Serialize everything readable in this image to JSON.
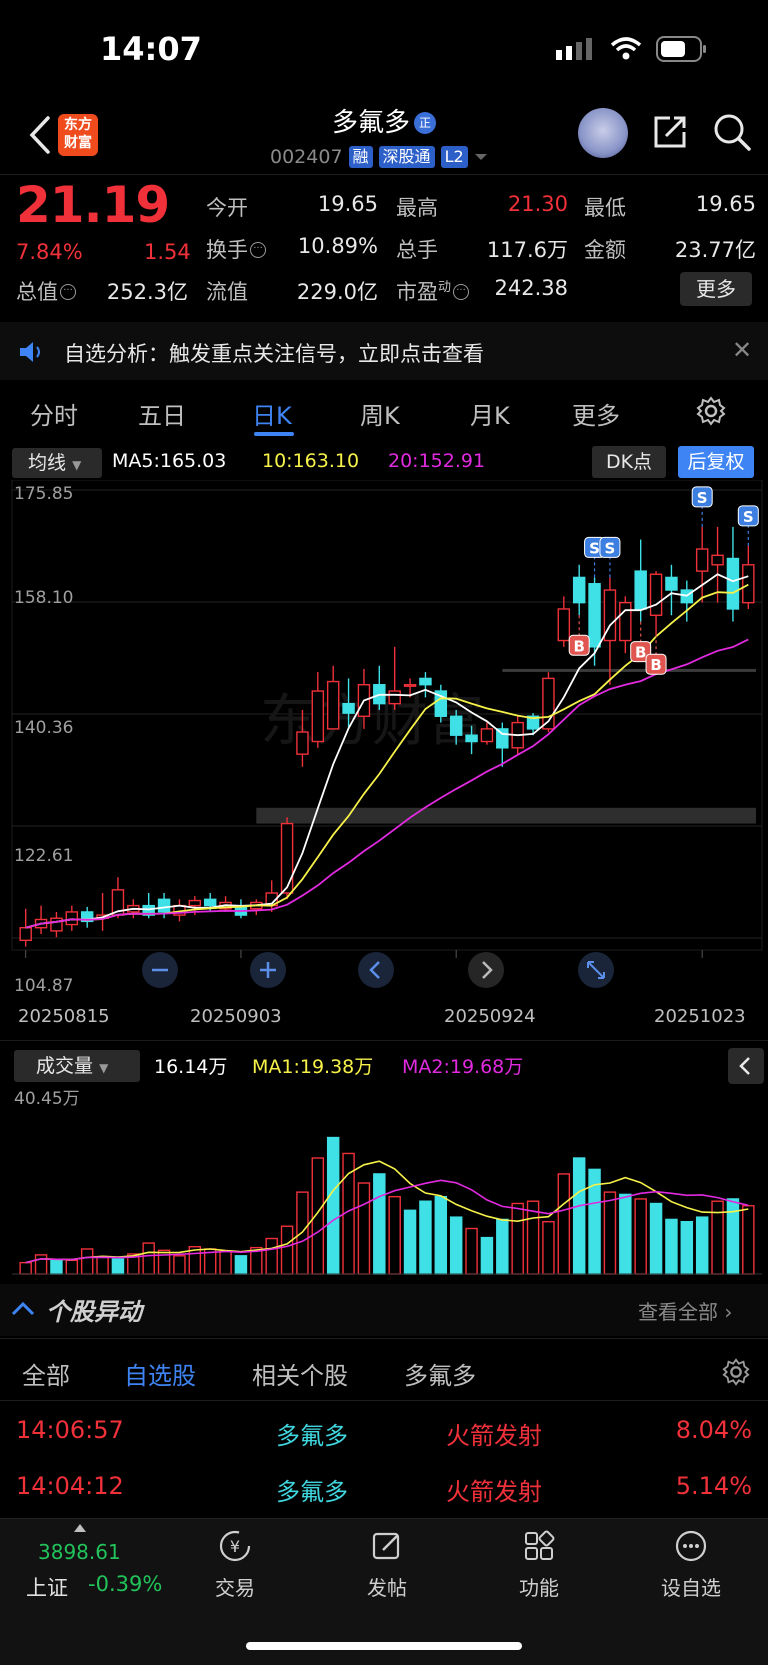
{
  "status": {
    "time": "14:07"
  },
  "header": {
    "logo_line1": "东方",
    "logo_line2": "财富",
    "stock_name": "多氟多",
    "name_tag": "正",
    "code": "002407",
    "badges": [
      "融",
      "深股通",
      "L2"
    ]
  },
  "quote": {
    "price": "21.19",
    "pct": "7.84%",
    "chg": "1.54",
    "fields": {
      "open_label": "今开",
      "open": "19.65",
      "high_label": "最高",
      "high": "21.30",
      "low_label": "最低",
      "low": "19.65",
      "turnover_label": "换手",
      "turnover": "10.89%",
      "vol_label": "总手",
      "vol": "117.6万",
      "amount_label": "金额",
      "amount": "23.77亿",
      "mcap_label": "总值",
      "mcap": "252.3亿",
      "float_label": "流值",
      "float": "229.0亿",
      "pe_label": "市盈",
      "pe_sup": "动",
      "pe": "242.38"
    },
    "more_label": "更多"
  },
  "banner": {
    "text": "自选分析：触发重点关注信号，立即点击查看"
  },
  "tabs": [
    "分时",
    "五日",
    "日K",
    "周K",
    "月K",
    "更多"
  ],
  "active_tab": "日K",
  "indicator": {
    "select_label": "均线",
    "ma5": "MA5:165.03",
    "ma10": "10:163.10",
    "ma20": "20:152.91",
    "dk_label": "DK点",
    "fq_label": "后复权"
  },
  "chart_data": {
    "type": "candlestick",
    "y_ticks": [
      "175.85",
      "158.10",
      "140.36",
      "122.61",
      "104.87"
    ],
    "ylim": [
      104.87,
      175.85
    ],
    "x_ticks": [
      "20250815",
      "20250903",
      "20250924",
      "20251023"
    ],
    "candles": [
      [
        104.5,
        106.5,
        103.5,
        109.5
      ],
      [
        106.5,
        107.8,
        105.5,
        110.0
      ],
      [
        106.0,
        108.0,
        105.0,
        109.0
      ],
      [
        107.0,
        109.0,
        106.0,
        110.0
      ],
      [
        109.0,
        107.5,
        106.5,
        109.8
      ],
      [
        108.0,
        108.5,
        106.0,
        112.0
      ],
      [
        108.5,
        112.5,
        108.0,
        114.5
      ],
      [
        109.0,
        110.0,
        108.0,
        111.0
      ],
      [
        110.0,
        108.5,
        108.0,
        112.0
      ],
      [
        111.0,
        109.0,
        108.0,
        112.0
      ],
      [
        108.5,
        110.0,
        107.5,
        111.0
      ],
      [
        110.0,
        110.8,
        108.5,
        111.5
      ],
      [
        111.0,
        110.0,
        109.0,
        112.0
      ],
      [
        109.5,
        110.5,
        109.0,
        111.5
      ],
      [
        110.0,
        108.5,
        108.0,
        111.0
      ],
      [
        109.5,
        110.5,
        108.5,
        111.0
      ],
      [
        110.0,
        112.0,
        109.0,
        114.0
      ],
      [
        112.0,
        123.0,
        111.0,
        124.0
      ],
      [
        134.0,
        137.5,
        132.0,
        141.0
      ],
      [
        136.0,
        144.0,
        135.0,
        147.0
      ],
      [
        138.0,
        145.5,
        138.0,
        148.0
      ],
      [
        142.0,
        140.5,
        138.0,
        146.0
      ],
      [
        140.0,
        145.0,
        138.0,
        147.5
      ],
      [
        145.0,
        142.0,
        141.0,
        148.0
      ],
      [
        142.0,
        144.0,
        141.0,
        151.0
      ],
      [
        145.0,
        145.0,
        143.0,
        146.0
      ],
      [
        146.0,
        145.0,
        143.0,
        147.0
      ],
      [
        144.0,
        140.0,
        139.0,
        145.0
      ],
      [
        140.0,
        137.0,
        135.5,
        141.0
      ],
      [
        137.0,
        136.0,
        134.0,
        138.5
      ],
      [
        136.0,
        138.0,
        135.5,
        139.0
      ],
      [
        138.0,
        135.0,
        132.0,
        139.0
      ],
      [
        135.0,
        139.0,
        134.0,
        140.0
      ],
      [
        140.0,
        138.0,
        137.0,
        140.5
      ],
      [
        138.0,
        146.0,
        137.5,
        147.0
      ],
      [
        152.0,
        157.0,
        151.0,
        159.0
      ],
      [
        162.0,
        158.0,
        156.0,
        164.0
      ],
      [
        161.0,
        151.0,
        148.0,
        162.0
      ],
      [
        152.0,
        160.0,
        145.0,
        162.0
      ],
      [
        152.0,
        158.0,
        150.0,
        159.0
      ],
      [
        163.0,
        157.0,
        155.0,
        168.0
      ],
      [
        156.0,
        162.5,
        153.0,
        163.0
      ],
      [
        162.0,
        160.0,
        156.0,
        164.0
      ],
      [
        160.0,
        158.0,
        155.0,
        161.5
      ],
      [
        163.0,
        166.5,
        158.0,
        170.0
      ],
      [
        164.0,
        165.5,
        158.0,
        170.0
      ],
      [
        165.0,
        157.0,
        155.0,
        170.0
      ],
      [
        158.0,
        164.0,
        157.0,
        167.0
      ]
    ],
    "ma_series": [
      {
        "name": "MA5",
        "color": "#ffffff"
      },
      {
        "name": "MA10",
        "color": "#f6f24a"
      },
      {
        "name": "MA20",
        "color": "#e22ae0"
      }
    ],
    "signals": [
      {
        "label": "B",
        "index": 36
      },
      {
        "label": "S",
        "index": 37
      },
      {
        "label": "S",
        "index": 38
      },
      {
        "label": "B",
        "index": 40
      },
      {
        "label": "B",
        "index": 41
      },
      {
        "label": "S",
        "index": 44
      },
      {
        "label": "S",
        "index": 47
      }
    ]
  },
  "volume": {
    "select_label": "成交量",
    "current": "16.14万",
    "ma1": "MA1:19.38万",
    "ma2": "MA2:19.68万",
    "max_label": "40.45万",
    "bars": [
      2.5,
      4.2,
      3.0,
      3.0,
      5.5,
      3.8,
      3.3,
      4.4,
      6.8,
      5.2,
      4.0,
      6.0,
      5.5,
      5.0,
      4.0,
      5.8,
      7.8,
      10.5,
      18.0,
      25.5,
      30.0,
      26.5,
      20.0,
      22.0,
      17.0,
      14.0,
      16.0,
      17.0,
      12.5,
      10.0,
      8.0,
      12.0,
      15.5,
      16.0,
      11.5,
      22.0,
      25.5,
      23.0,
      18.0,
      17.5,
      16.5,
      15.5,
      12.0,
      11.5,
      12.5,
      16.0,
      16.5,
      15.0
    ],
    "ups": [
      1,
      1,
      0,
      1,
      1,
      1,
      0,
      1,
      1,
      1,
      1,
      1,
      1,
      1,
      0,
      1,
      1,
      1,
      1,
      1,
      0,
      1,
      1,
      0,
      1,
      0,
      0,
      0,
      0,
      1,
      0,
      0,
      1,
      1,
      1,
      1,
      0,
      0,
      1,
      0,
      1,
      0,
      0,
      0,
      0,
      1,
      0,
      1
    ]
  },
  "anomaly": {
    "title": "个股异动",
    "view_all": "查看全部",
    "tabs": [
      "全部",
      "自选股",
      "相关个股",
      "多氟多"
    ],
    "active_tab": "自选股",
    "rows": [
      {
        "time": "14:06:57",
        "name": "多氟多",
        "signal": "火箭发射",
        "pct": "8.04%"
      },
      {
        "time": "14:04:12",
        "name": "多氟多",
        "signal": "火箭发射",
        "pct": "5.14%"
      }
    ]
  },
  "bottom": {
    "index_value": "3898.61",
    "index_name": "上证",
    "index_chg": "-0.39%",
    "nav": [
      "交易",
      "发帖",
      "功能",
      "设自选"
    ]
  }
}
